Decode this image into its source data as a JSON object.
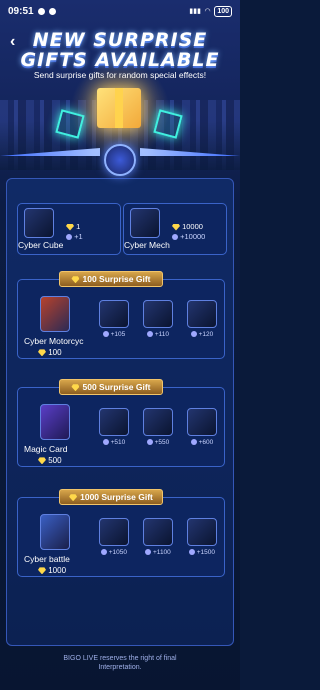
{
  "status_bar": {
    "time": "09:51",
    "battery": "100"
  },
  "header": {
    "title_line1": "NEW SURPRISE",
    "title_line2": "GIFTS AVAILABLE",
    "subtitle": "Send surprise gifts for random special effects!"
  },
  "rewards": [
    {
      "name": "Cyber Cube",
      "cost": "1",
      "bonus": "+1"
    },
    {
      "name": "Cyber Mech Ra",
      "cost": "10000",
      "bonus": "+10000"
    }
  ],
  "tiers": [
    {
      "header": "100 Surprise Gift",
      "main_name": "Cyber Motorcycle",
      "main_cost": "100",
      "subs": [
        "+105",
        "+110",
        "+120"
      ]
    },
    {
      "header": "500 Surprise Gift",
      "main_name": "Magic Card",
      "main_cost": "500",
      "subs": [
        "+510",
        "+550",
        "+600"
      ]
    },
    {
      "header": "1000 Surprise Gift",
      "main_name": "Cyber battle",
      "main_cost": "1000",
      "subs": [
        "+1050",
        "+1100",
        "+1500"
      ]
    }
  ],
  "footer": {
    "line1": "BIGO LIVE reserves the right of final",
    "line2": "Interpretation."
  },
  "colors": {
    "accent_gold": "#d8a64a",
    "panel_blue": "#0d2560",
    "border_blue": "#3a63c8"
  }
}
